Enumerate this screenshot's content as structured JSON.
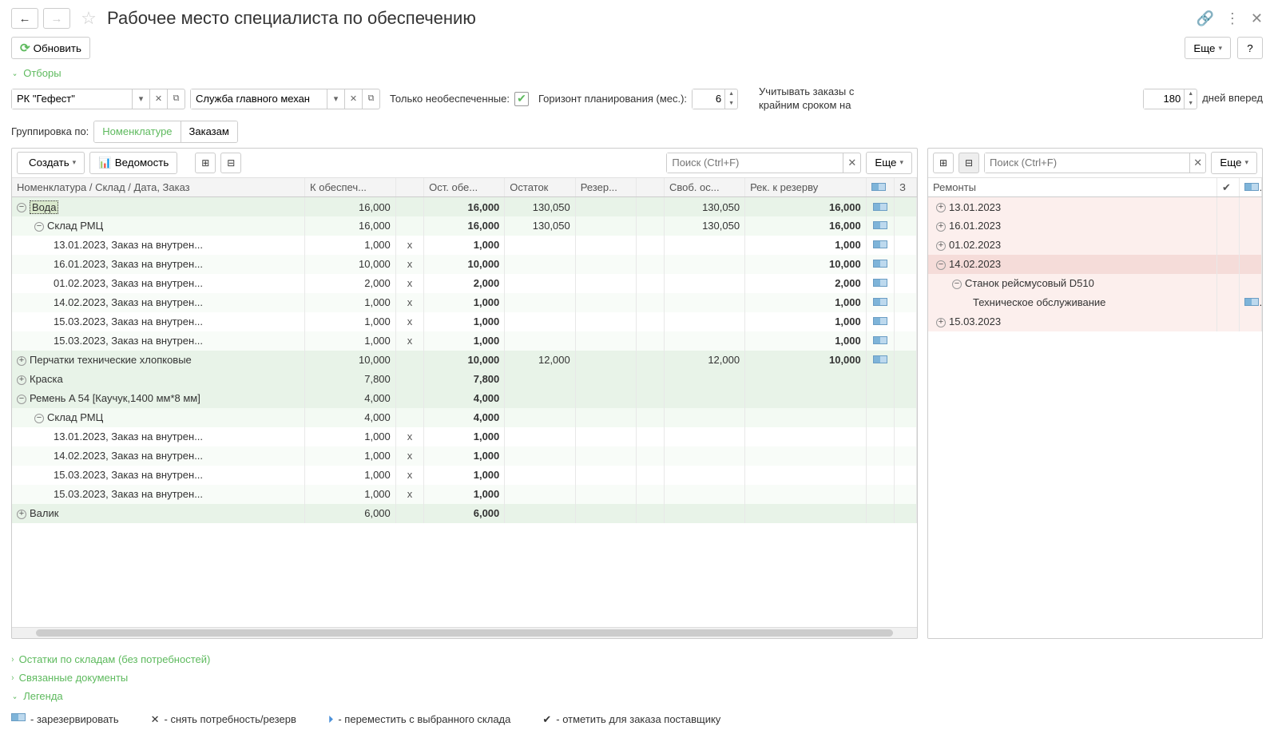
{
  "title": "Рабочее место специалиста по обеспечению",
  "toolbar": {
    "refresh": "Обновить",
    "more": "Еще",
    "help": "?"
  },
  "filters": {
    "header": "Отборы",
    "company": "РК \"Гефест\"",
    "dept": "Служба главного механ",
    "only_unprovided_label": "Только необеспеченные:",
    "horizon_label": "Горизонт планирования (мес.):",
    "horizon_value": "6",
    "orders_label_1": "Учитывать заказы с",
    "orders_label_2": "крайним сроком  на",
    "days_value": "180",
    "days_label": "дней вперед"
  },
  "group": {
    "label": "Группировка по:",
    "opt1": "Номенклатуре",
    "opt2": "Заказам"
  },
  "left": {
    "create": "Создать",
    "report": "Ведомость",
    "search_ph": "Поиск (Ctrl+F)",
    "more": "Еще",
    "cols": {
      "c1": "Номенклатура / Склад / Дата, Заказ",
      "c2": "К обеспеч...",
      "c3": "",
      "c4": "Ост. обе...",
      "c5": "Остаток",
      "c6": "Резер...",
      "c7": "",
      "c8": "Своб. ос...",
      "c9": "Рек. к резерву",
      "c10": "",
      "c11": "З"
    },
    "rows": [
      {
        "lvl": 0,
        "exp": "-",
        "name": "Вода",
        "c2": "16,000",
        "c4": "16,000",
        "c5": "130,050",
        "c8": "130,050",
        "c9": "16,000",
        "rsv": true,
        "sel": true
      },
      {
        "lvl": 1,
        "exp": "-",
        "name": "Склад РМЦ",
        "c2": "16,000",
        "c4": "16,000",
        "c5": "130,050",
        "c8": "130,050",
        "c9": "16,000",
        "rsv": true
      },
      {
        "lvl": 2,
        "name": "13.01.2023, Заказ на внутрен...",
        "c2": "1,000",
        "x": "x",
        "c4": "1,000",
        "c9": "1,000",
        "rsv": true
      },
      {
        "lvl": 2,
        "alt": true,
        "name": "16.01.2023, Заказ на внутрен...",
        "c2": "10,000",
        "x": "x",
        "c4": "10,000",
        "c9": "10,000",
        "rsv": true
      },
      {
        "lvl": 2,
        "name": "01.02.2023, Заказ на внутрен...",
        "c2": "2,000",
        "x": "x",
        "c4": "2,000",
        "c9": "2,000",
        "rsv": true
      },
      {
        "lvl": 2,
        "alt": true,
        "name": "14.02.2023, Заказ на внутрен...",
        "c2": "1,000",
        "x": "x",
        "c4": "1,000",
        "c9": "1,000",
        "rsv": true
      },
      {
        "lvl": 2,
        "name": "15.03.2023, Заказ на внутрен...",
        "c2": "1,000",
        "x": "x",
        "c4": "1,000",
        "c9": "1,000",
        "rsv": true
      },
      {
        "lvl": 2,
        "alt": true,
        "name": "15.03.2023, Заказ на внутрен...",
        "c2": "1,000",
        "x": "x",
        "c4": "1,000",
        "c9": "1,000",
        "rsv": true
      },
      {
        "lvl": 0,
        "exp": "+",
        "name": "Перчатки технические хлопковые",
        "c2": "10,000",
        "c4": "10,000",
        "c5": "12,000",
        "c8": "12,000",
        "c9": "10,000",
        "rsv": true
      },
      {
        "lvl": 0,
        "exp": "+",
        "name": "Краска",
        "c2": "7,800",
        "c4": "7,800"
      },
      {
        "lvl": 0,
        "exp": "-",
        "name": "Ремень A 54 [Каучук,1400 мм*8 мм]",
        "c2": "4,000",
        "c4": "4,000"
      },
      {
        "lvl": 1,
        "exp": "-",
        "name": "Склад РМЦ",
        "c2": "4,000",
        "c4": "4,000"
      },
      {
        "lvl": 2,
        "name": "13.01.2023, Заказ на внутрен...",
        "c2": "1,000",
        "x": "x",
        "c4": "1,000"
      },
      {
        "lvl": 2,
        "alt": true,
        "name": "14.02.2023, Заказ на внутрен...",
        "c2": "1,000",
        "x": "x",
        "c4": "1,000"
      },
      {
        "lvl": 2,
        "name": "15.03.2023, Заказ на внутрен...",
        "c2": "1,000",
        "x": "x",
        "c4": "1,000"
      },
      {
        "lvl": 2,
        "alt": true,
        "name": "15.03.2023, Заказ на внутрен...",
        "c2": "1,000",
        "x": "x",
        "c4": "1,000"
      },
      {
        "lvl": 0,
        "exp": "+",
        "name": "Валик",
        "c2": "6,000",
        "c4": "6,000"
      }
    ]
  },
  "right": {
    "search_ph": "Поиск (Ctrl+F)",
    "more": "Еще",
    "header": "Ремонты",
    "rows": [
      {
        "lvl": 0,
        "exp": "+",
        "name": "13.01.2023"
      },
      {
        "lvl": 0,
        "exp": "+",
        "name": "16.01.2023"
      },
      {
        "lvl": 0,
        "exp": "+",
        "name": "01.02.2023"
      },
      {
        "lvl": 0,
        "exp": "-",
        "name": "14.02.2023",
        "sel": true
      },
      {
        "lvl": 1,
        "exp": "-",
        "name": "Станок рейсмусовый D510"
      },
      {
        "lvl": 2,
        "name": "Техническое обслуживание",
        "rsv": true
      },
      {
        "lvl": 0,
        "exp": "+",
        "name": "15.03.2023"
      }
    ]
  },
  "collapsibles": {
    "stock": "Остатки по складам (без потребностей)",
    "docs": "Связанные документы",
    "legend": "Легенда"
  },
  "legend": {
    "i1": "- зарезервировать",
    "i2": "- снять потребность/резерв",
    "i3": "- переместить с выбранного склада",
    "i4": "- отметить для заказа поставщику"
  }
}
